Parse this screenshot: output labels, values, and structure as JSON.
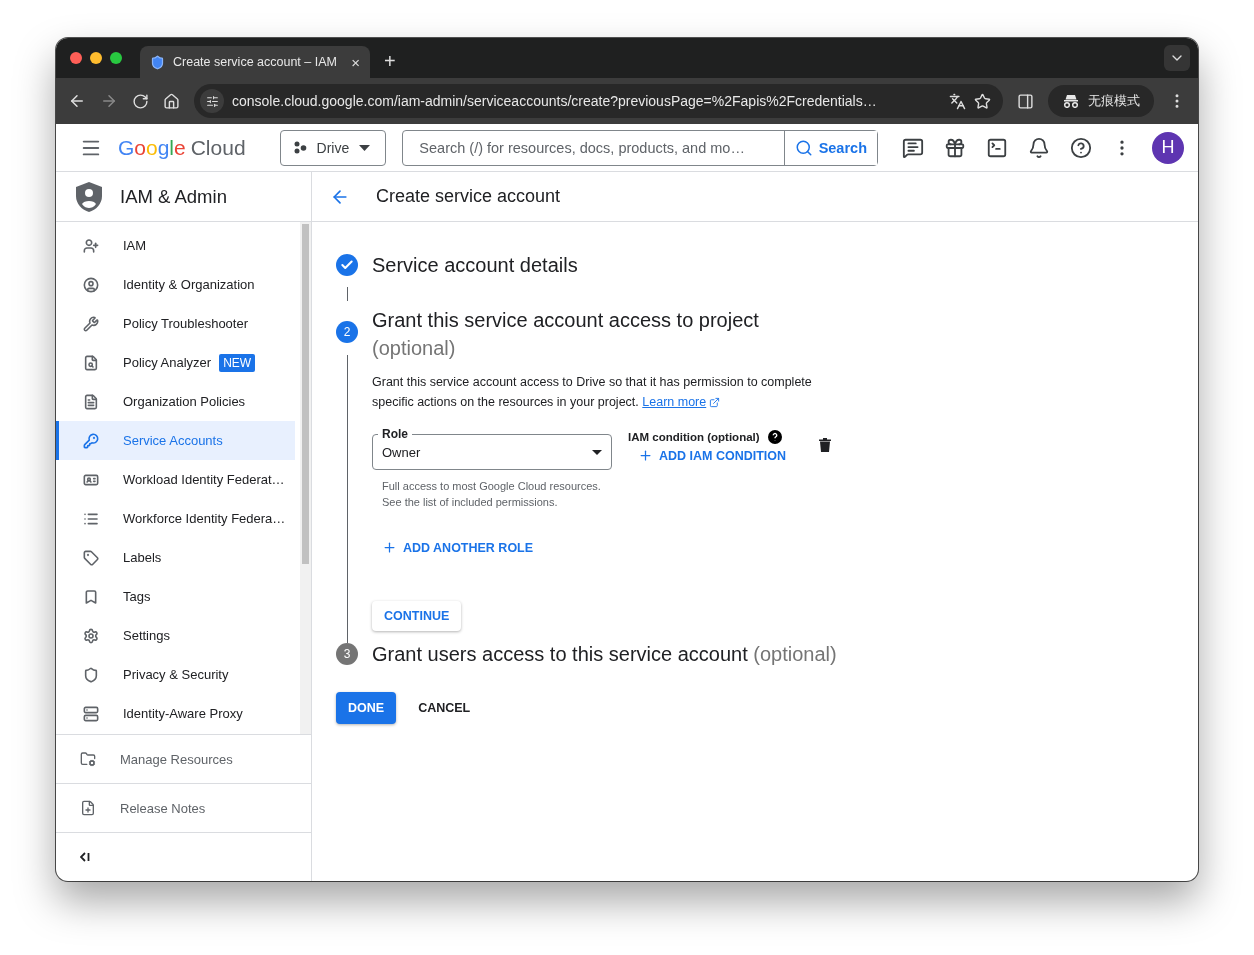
{
  "browser": {
    "tab": {
      "title": "Create service account – IAM",
      "close": "×"
    },
    "new_tab": "+",
    "url": "console.cloud.google.com/iam-admin/serviceaccounts/create?previousPage=%2Fapis%2Fcredentials…",
    "profile": "无痕模式"
  },
  "topbar": {
    "logo": {
      "brand": "Google",
      "product": "Cloud"
    },
    "project": "Drive",
    "search": {
      "placeholder": "Search (/) for resources, docs, products, and mo…",
      "button": "Search"
    },
    "avatar": "H"
  },
  "sidebar": {
    "title": "IAM & Admin",
    "items": [
      {
        "label": "IAM",
        "selected": false
      },
      {
        "label": "Identity & Organization",
        "selected": false
      },
      {
        "label": "Policy Troubleshooter",
        "selected": false
      },
      {
        "label": "Policy Analyzer",
        "selected": false,
        "badge": "NEW"
      },
      {
        "label": "Organization Policies",
        "selected": false
      },
      {
        "label": "Service Accounts",
        "selected": true
      },
      {
        "label": "Workload Identity Federat…",
        "selected": false
      },
      {
        "label": "Workforce Identity Federa…",
        "selected": false
      },
      {
        "label": "Labels",
        "selected": false
      },
      {
        "label": "Tags",
        "selected": false
      },
      {
        "label": "Settings",
        "selected": false
      },
      {
        "label": "Privacy & Security",
        "selected": false
      },
      {
        "label": "Identity-Aware Proxy",
        "selected": false
      }
    ],
    "footer": [
      {
        "label": "Manage Resources"
      },
      {
        "label": "Release Notes"
      }
    ]
  },
  "page": {
    "title": "Create service account",
    "steps": [
      {
        "done": true,
        "current": false,
        "title": "Service account details"
      },
      {
        "done": false,
        "current": true,
        "number": "2",
        "title": "Grant this service account access to project",
        "optional": "(optional)",
        "description": "Grant this service account access to Drive so that it has permission to complete specific actions on the resources in your project.",
        "link": "Learn more",
        "role": {
          "label": "Role",
          "value": "Owner",
          "hint": "Full access to most Google Cloud resources. See the list of included permissions."
        },
        "condition": {
          "label": "IAM condition (optional)",
          "action": "ADD IAM CONDITION"
        },
        "add_role": "ADD ANOTHER ROLE",
        "continue": "CONTINUE"
      },
      {
        "done": false,
        "current": false,
        "number": "3",
        "title": "Grant users access to this service account",
        "optional": "(optional)"
      }
    ],
    "actions": {
      "done": "DONE",
      "cancel": "CANCEL"
    }
  }
}
